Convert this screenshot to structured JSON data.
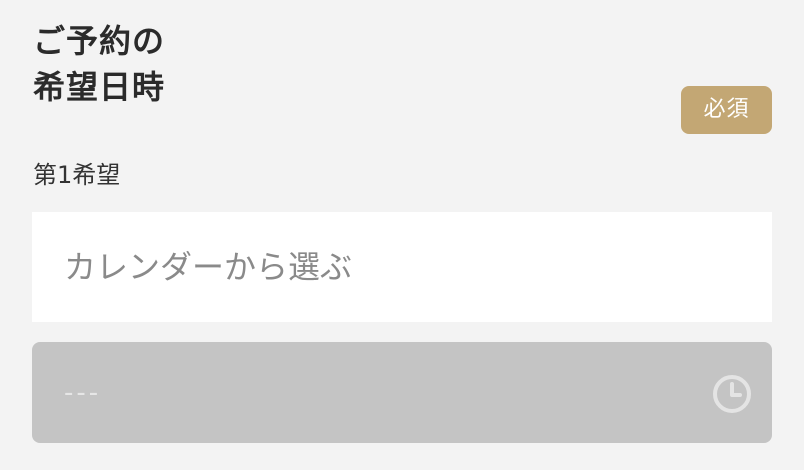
{
  "form": {
    "title_line1": "ご予約の",
    "title_line2": "希望日時",
    "required_badge": "必須",
    "preference_label": "第1希望",
    "date_placeholder": "カレンダーから選ぶ",
    "time_value": "---"
  },
  "icons": {
    "time": "clock-icon"
  },
  "colors": {
    "background": "#f3f3f3",
    "badge": "#c3a774",
    "disabled_field": "#c4c4c4",
    "placeholder": "#8a8a8a"
  }
}
